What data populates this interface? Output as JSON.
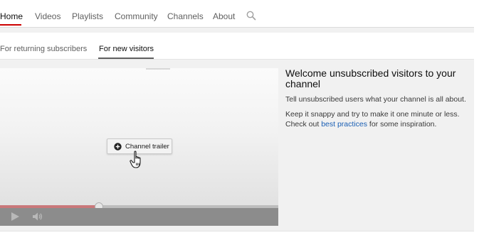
{
  "nav": {
    "tabs": [
      {
        "label": "Home",
        "active": true
      },
      {
        "label": "Videos",
        "active": false
      },
      {
        "label": "Playlists",
        "active": false
      },
      {
        "label": "Community",
        "active": false
      },
      {
        "label": "Channels",
        "active": false
      },
      {
        "label": "About",
        "active": false
      }
    ],
    "search_icon": "search-icon",
    "accent_color": "#cc0000"
  },
  "subtabs": [
    {
      "label": "For returning subscribers",
      "active": false
    },
    {
      "label": "For new visitors",
      "active": true
    }
  ],
  "video": {
    "trailer_button_label": "Channel trailer",
    "trailer_icon": "plus-circle-icon",
    "cursor_icon": "hand-pointer-icon",
    "progress_fraction": 0.355,
    "progress_color": "#c9787a",
    "play_icon": "play-icon",
    "volume_icon": "volume-icon"
  },
  "info": {
    "title": "Welcome unsubscribed visitors to your channel",
    "description": "Tell unsubscribed users what your channel is all about.",
    "tip_before": "Keep it snappy and try to make it one minute or less. Check out ",
    "tip_link": "best practices",
    "tip_after": " for some inspiration.",
    "link_color": "#1a5fb4"
  }
}
